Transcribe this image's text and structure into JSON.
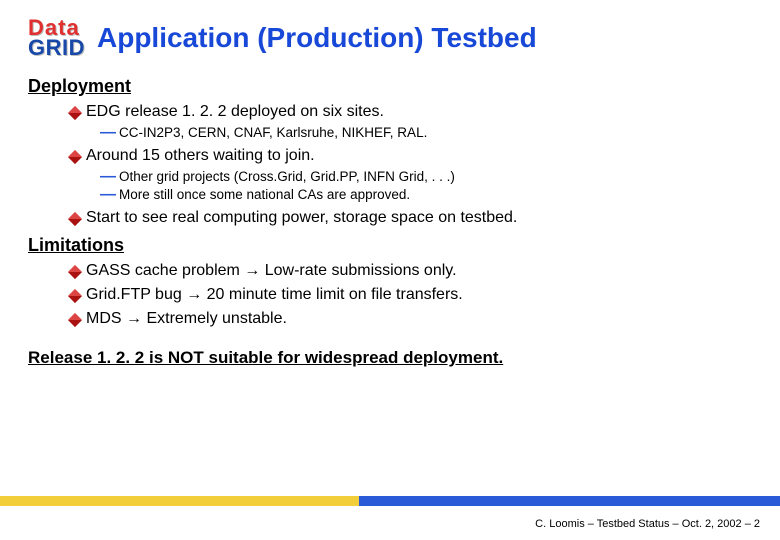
{
  "logo": {
    "top": "Data",
    "bottom": "GRID"
  },
  "title": "Application (Production) Testbed",
  "sections": [
    {
      "heading": "Deployment",
      "bullets": [
        {
          "text": "EDG release 1. 2. 2 deployed on six sites.",
          "sub": [
            "CC-IN2P3, CERN, CNAF, Karlsruhe, NIKHEF, RAL."
          ]
        },
        {
          "text": "Around 15 others waiting to join.",
          "sub": [
            "Other grid projects (Cross.Grid, Grid.PP, INFN Grid, . . .)",
            "More still once some national CAs are approved."
          ]
        },
        {
          "text": "Start to see real computing power, storage space on testbed.",
          "sub": []
        }
      ]
    },
    {
      "heading": "Limitations",
      "bullets": [
        {
          "text": "GASS cache problem → Low-rate submissions only.",
          "sub": []
        },
        {
          "text": "Grid.FTP bug → 20 minute time limit on file transfers.",
          "sub": []
        },
        {
          "text": "MDS → Extremely unstable.",
          "sub": []
        }
      ]
    }
  ],
  "conclusion": "Release 1. 2. 2 is NOT suitable for widespread deployment.",
  "footer": "C. Loomis – Testbed Status – Oct. 2, 2002 – 2"
}
